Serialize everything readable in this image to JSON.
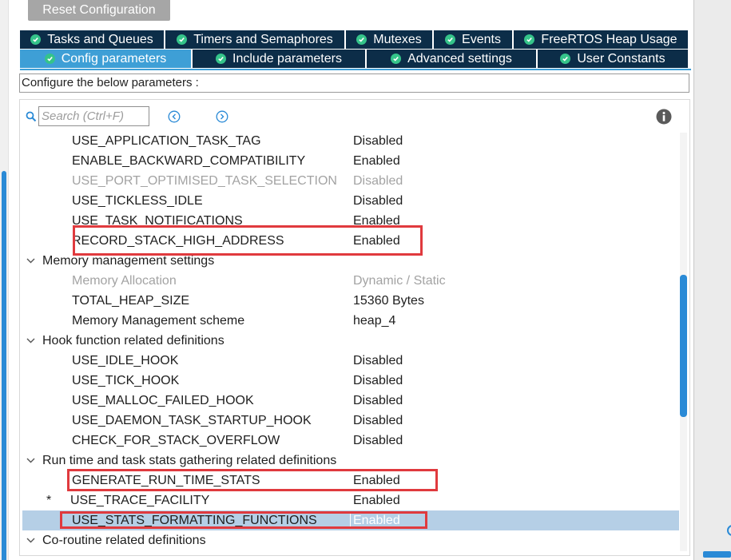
{
  "toolbar": {
    "reset_label": "Reset Configuration"
  },
  "tabs_row1": [
    {
      "label": "Tasks and Queues"
    },
    {
      "label": "Timers and Semaphores"
    },
    {
      "label": "Mutexes"
    },
    {
      "label": "Events"
    },
    {
      "label": "FreeRTOS Heap Usage"
    }
  ],
  "tabs_row2": [
    {
      "label": "Config parameters",
      "active": true
    },
    {
      "label": "Include parameters"
    },
    {
      "label": "Advanced settings"
    },
    {
      "label": "User Constants"
    }
  ],
  "instructions": "Configure the below parameters :",
  "search": {
    "placeholder": "Search (Ctrl+F)",
    "value": ""
  },
  "icons": {
    "check": "check-circle-icon",
    "search": "search-icon",
    "prev": "previous-arrow-icon",
    "next": "next-arrow-icon",
    "info": "info-icon",
    "expand": "chevron-down-icon"
  },
  "colors": {
    "tab_bg": "#0c2d48",
    "tab_active": "#3e9fd6",
    "check": "#35c48a",
    "highlight_box": "#e03a3e",
    "selected_row": "#b5cfe6",
    "scrollbar": "#2a8ad6"
  },
  "rows": [
    {
      "type": "param",
      "name": "USE_APPLICATION_TASK_TAG",
      "value": "Disabled"
    },
    {
      "type": "param",
      "name": "ENABLE_BACKWARD_COMPATIBILITY",
      "value": "Enabled"
    },
    {
      "type": "param",
      "name": "USE_PORT_OPTIMISED_TASK_SELECTION",
      "value": "Disabled",
      "disabled": true
    },
    {
      "type": "param",
      "name": "USE_TICKLESS_IDLE",
      "value": "Disabled"
    },
    {
      "type": "param",
      "name": "USE_TASK_NOTIFICATIONS",
      "value": "Enabled"
    },
    {
      "type": "param",
      "name": "RECORD_STACK_HIGH_ADDRESS",
      "value": "Enabled"
    },
    {
      "type": "group",
      "name": "Memory management settings"
    },
    {
      "type": "param",
      "name": "Memory Allocation",
      "value": "Dynamic / Static",
      "disabled": true
    },
    {
      "type": "param",
      "name": "TOTAL_HEAP_SIZE",
      "value": "15360 Bytes"
    },
    {
      "type": "param",
      "name": "Memory Management scheme",
      "value": "heap_4"
    },
    {
      "type": "group",
      "name": "Hook function related definitions"
    },
    {
      "type": "param",
      "name": "USE_IDLE_HOOK",
      "value": "Disabled"
    },
    {
      "type": "param",
      "name": "USE_TICK_HOOK",
      "value": "Disabled"
    },
    {
      "type": "param",
      "name": "USE_MALLOC_FAILED_HOOK",
      "value": "Disabled"
    },
    {
      "type": "param",
      "name": "USE_DAEMON_TASK_STARTUP_HOOK",
      "value": "Disabled"
    },
    {
      "type": "param",
      "name": "CHECK_FOR_STACK_OVERFLOW",
      "value": "Disabled"
    },
    {
      "type": "group",
      "name": "Run time and task stats gathering related definitions"
    },
    {
      "type": "param",
      "name": "GENERATE_RUN_TIME_STATS",
      "value": "Enabled"
    },
    {
      "type": "param",
      "name": "USE_TRACE_FACILITY",
      "value": "Enabled",
      "marker": "*"
    },
    {
      "type": "param",
      "name": "USE_STATS_FORMATTING_FUNCTIONS",
      "value": "Enabled",
      "selected": true
    },
    {
      "type": "group",
      "name": "Co-routine related definitions"
    }
  ]
}
